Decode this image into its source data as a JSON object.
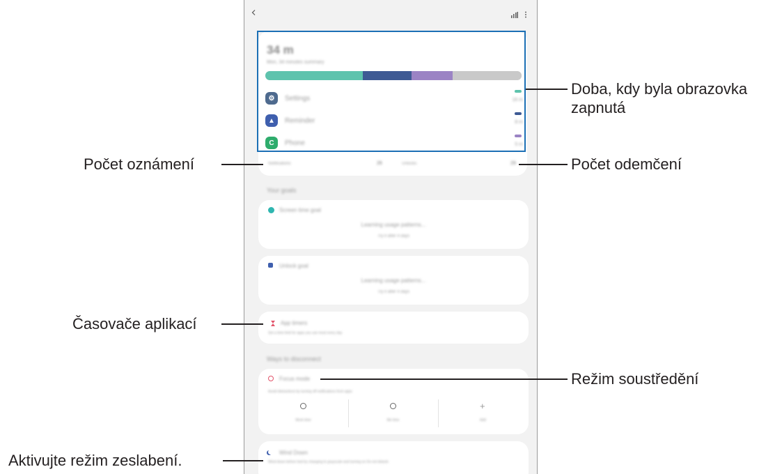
{
  "phone": {
    "header": {
      "back_icon": "back-arrow-icon",
      "chart_icon": "bar-chart-icon",
      "more_icon": "more-vertical-icon"
    },
    "summary": {
      "total_time": "34 m",
      "subtitle": "Mon, 34 minutes summary",
      "bar_segments": [
        {
          "color": "#5ec3ad",
          "fraction": 0.38
        },
        {
          "color": "#3e5a94",
          "fraction": 0.19
        },
        {
          "color": "#9b83c4",
          "fraction": 0.16
        },
        {
          "color": "#c9c9c9",
          "fraction": 0.27
        }
      ],
      "apps": [
        {
          "name": "Settings",
          "time": "16 m",
          "icon": "gear-icon",
          "color": "#4e6a8e",
          "pill": "#5ec3ad"
        },
        {
          "name": "Reminder",
          "time": "8 m",
          "icon": "bell-icon",
          "color": "#3f5fae",
          "pill": "#3e5a94"
        },
        {
          "name": "Phone",
          "time": "5 m",
          "icon": "phone-icon",
          "color": "#2eac6c",
          "pill": "#9b83c4"
        }
      ],
      "notifications_label": "Notifications",
      "notifications_count": "26",
      "unlocks_label": "Unlocks",
      "unlocks_count": "29"
    },
    "goals_title": "Your goals",
    "screen_time_goal": {
      "title": "Screen time goal",
      "status": "Learning usage patterns...",
      "note": "Try it after 4 days"
    },
    "unlock_goal": {
      "title": "Unlock goal",
      "status": "Learning usage patterns...",
      "note": "Try it after 4 days"
    },
    "app_timers": {
      "title": "App timers",
      "desc": "Set a time limit for apps you use most every day"
    },
    "ways_title": "Ways to disconnect",
    "focus_mode": {
      "title": "Focus mode",
      "desc": "Avoid distractions by turning off notifications from apps",
      "modes": [
        {
          "label": "Work time",
          "icon": "focus-work-icon"
        },
        {
          "label": "Me time",
          "icon": "focus-me-icon"
        },
        {
          "label": "Add",
          "icon": "plus-icon"
        }
      ]
    },
    "wind_down": {
      "title": "Wind Down",
      "desc": "Wind down before bed by changing to grayscale and turning on Do not disturb"
    }
  },
  "callouts": {
    "screen_on": "Doba, kdy byla obrazovka\nzapnutá",
    "notifications": "Počet oznámení",
    "unlocks": "Počet odemčení",
    "app_timers": "Časovače aplikací",
    "focus_mode": "Režim soustředění",
    "wind_down": "Aktivujte režim zeslabení."
  },
  "colors": {
    "highlight": "#1b6fb5",
    "callout_line": "#231f20"
  }
}
